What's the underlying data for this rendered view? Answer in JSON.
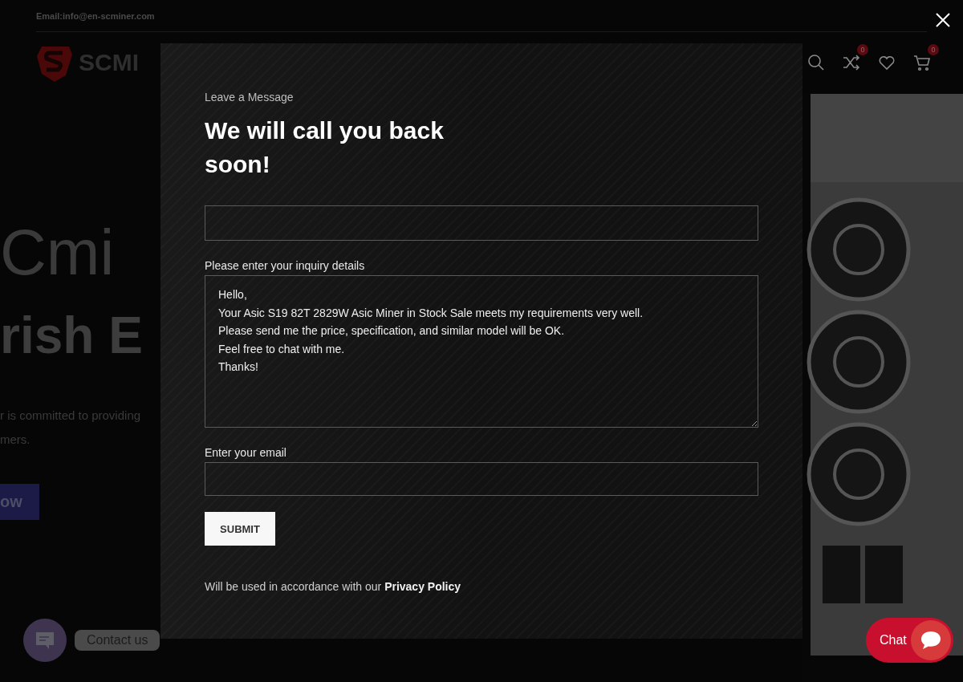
{
  "top_bar": {
    "email": "Email:info@en-scminer.com"
  },
  "header": {
    "logo_text": "SCMI",
    "icons": [
      {
        "kind": "search"
      },
      {
        "kind": "shuffle",
        "badge": "0"
      },
      {
        "kind": "heart"
      },
      {
        "kind": "cart",
        "badge": "0"
      }
    ]
  },
  "hero": {
    "title_light": "Cmi",
    "title_bold": "rish E",
    "text": "r is committed to providing",
    "text_2": "mers.",
    "button": "ow"
  },
  "dialog": {
    "eyebrow": "Leave a Message",
    "title": "We will call you back soon!",
    "fields": [
      {
        "kind": "input"
      },
      {
        "kind": "textarea",
        "label": "Please enter your inquiry details",
        "value": "Hello,\nYour Asic S19 82T 2829W Asic Miner in Stock Sale meets my requirements very well.\nPlease send me the price, specification, and similar model will be OK.\nFeel free to chat with me.\nThanks!"
      },
      {
        "kind": "input",
        "label": "Enter your email"
      }
    ],
    "submit": "SUBMIT",
    "note": "Will be used in accordance with our",
    "note_link": "Privacy Policy"
  },
  "contact_widget": {
    "label": "Contact us"
  },
  "chat_widget": {
    "label": "Chat"
  }
}
